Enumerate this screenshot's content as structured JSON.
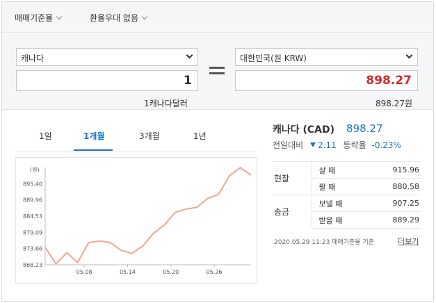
{
  "filters": {
    "rate_type": "매매기준율",
    "preference": "환율우대 없음"
  },
  "converter": {
    "from_currency": "캐나다",
    "from_amount": "1",
    "from_unit": "1캐나다달러",
    "to_currency": "대한민국(원 KRW)",
    "to_amount": "898.27",
    "to_unit": "898.27원"
  },
  "tabs": [
    "1일",
    "1개월",
    "3개월",
    "1년"
  ],
  "active_tab": "1개월",
  "summary": {
    "title": "캐나다 (CAD)",
    "rate": "898.27",
    "change_label": "전일대비",
    "change_value": "2.11",
    "change_word": "등락율",
    "change_pct": "-0.23%"
  },
  "rate_table": {
    "groups": [
      {
        "name": "현찰",
        "rows": [
          {
            "label": "살 때",
            "value": "915.96"
          },
          {
            "label": "팔 때",
            "value": "880.58"
          }
        ]
      },
      {
        "name": "송금",
        "rows": [
          {
            "label": "보낼 때",
            "value": "907.25"
          },
          {
            "label": "받을 때",
            "value": "889.29"
          }
        ]
      }
    ]
  },
  "footnote": "2020.05.29 11:23 매매기준율 기준",
  "more_label": "더보기",
  "colors": {
    "accent_blue": "#1a73c4",
    "highlight_red": "#d62a2a",
    "line": "#f2a68a"
  },
  "chart_data": {
    "type": "line",
    "unit_label": "(원)",
    "y_ticks": [
      "895.40",
      "889.96",
      "884.53",
      "879.09",
      "873.66",
      "868.23"
    ],
    "x_ticks": [
      "05.08",
      "05.14",
      "05.20",
      "05.26"
    ],
    "ylim": [
      868.23,
      900.84
    ],
    "grid": false,
    "series": [
      {
        "values": [
          874.0,
          868.6,
          872.3,
          869.0,
          875.6,
          876.2,
          875.7,
          873.1,
          872.0,
          874.5,
          878.8,
          881.6,
          885.8,
          886.9,
          887.5,
          890.5,
          891.8,
          898.0,
          900.8,
          898.3
        ]
      }
    ]
  }
}
